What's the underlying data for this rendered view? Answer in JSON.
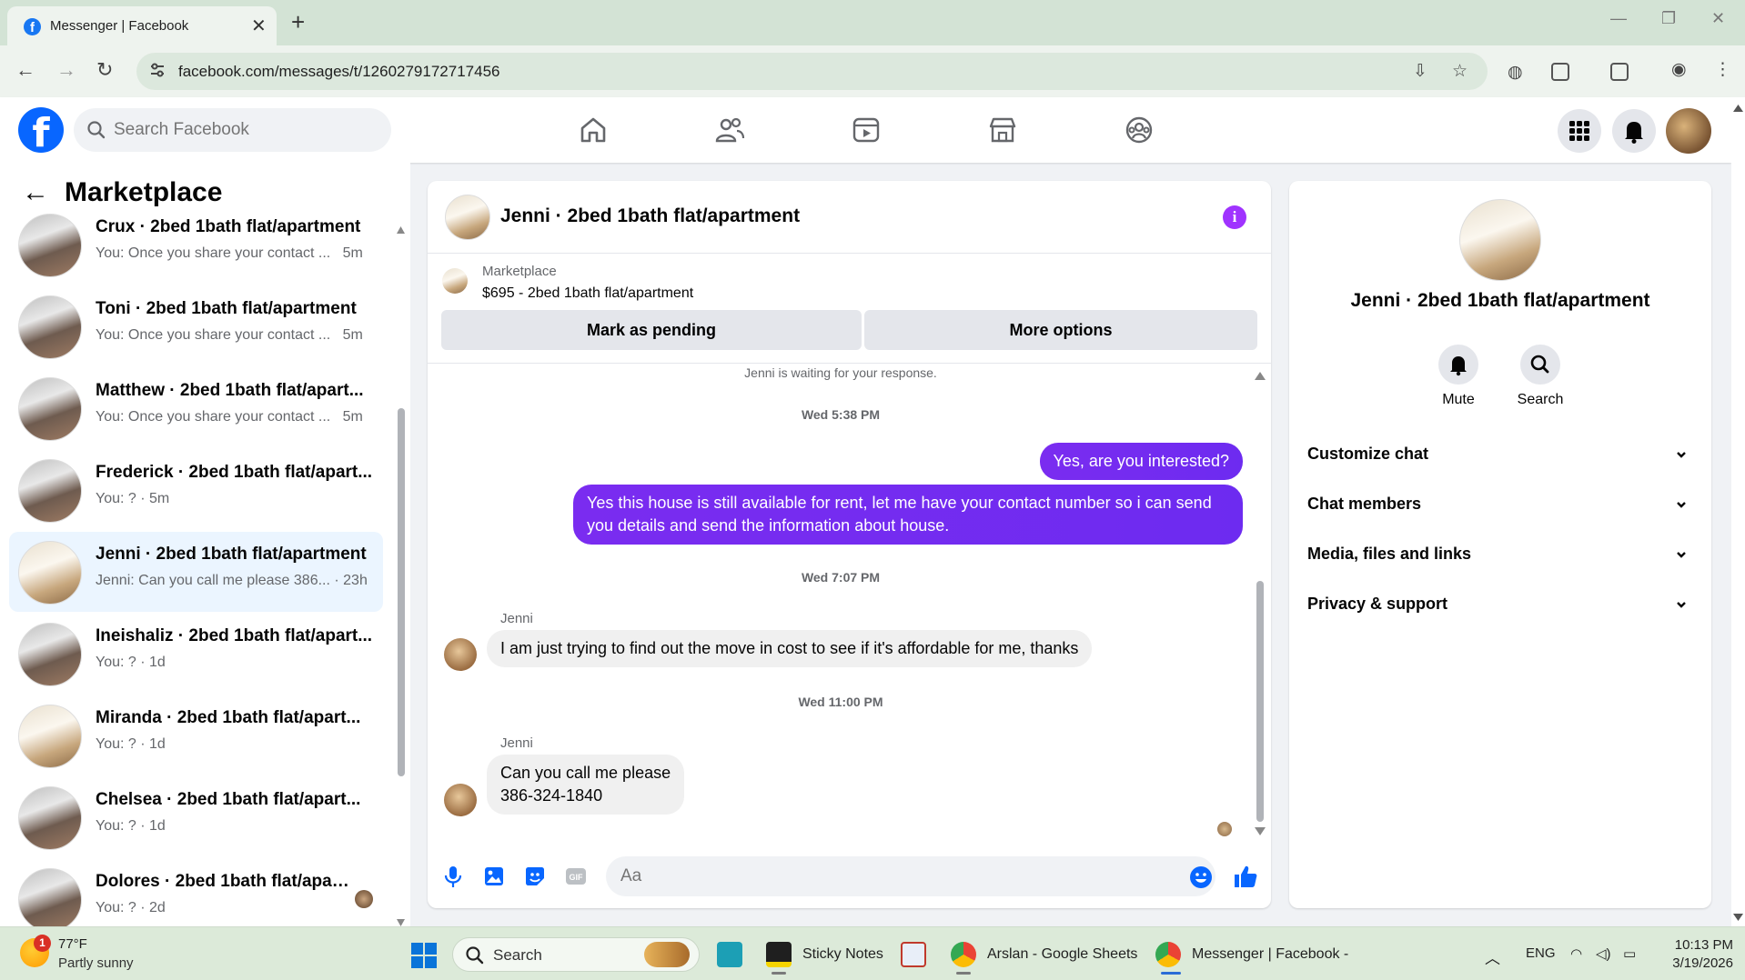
{
  "browser": {
    "tab_title": "Messenger | Facebook",
    "url": "facebook.com/messages/t/1260279172717456"
  },
  "header": {
    "search_placeholder": "Search Facebook"
  },
  "sidebar": {
    "title": "Marketplace",
    "conversations": [
      {
        "name": "Crux · 2bed 1bath flat/apartment",
        "preview": "You: Once you share your contact ...",
        "time": "5m",
        "active": false
      },
      {
        "name": "Toni · 2bed 1bath flat/apartment",
        "preview": "You: Once you share your contact ...",
        "time": "5m",
        "active": false
      },
      {
        "name": "Matthew · 2bed 1bath flat/apart...",
        "preview": "You: Once you share your contact ...",
        "time": "5m",
        "active": false
      },
      {
        "name": "Frederick · 2bed 1bath flat/apart...",
        "preview": "You: ? · 5m",
        "time": "",
        "active": false
      },
      {
        "name": "Jenni · 2bed 1bath flat/apartment",
        "preview": "Jenni: Can you call me please 386... · 23h",
        "time": "",
        "active": true
      },
      {
        "name": "Ineishaliz · 2bed 1bath flat/apart...",
        "preview": "You: ? · 1d",
        "time": "",
        "active": false
      },
      {
        "name": "Miranda · 2bed 1bath flat/apart...",
        "preview": "You: ? · 1d",
        "time": "",
        "active": false
      },
      {
        "name": "Chelsea · 2bed 1bath flat/apart...",
        "preview": "You: ? · 1d",
        "time": "",
        "active": false
      },
      {
        "name": "Dolores · 2bed 1bath flat/apar...",
        "preview": "You: ? · 2d",
        "time": "",
        "active": false
      }
    ]
  },
  "chat": {
    "title": "Jenni · 2bed 1bath flat/apartment",
    "listing_label": "Marketplace",
    "listing_price": "$695 - 2bed 1bath flat/apartment",
    "mark_pending": "Mark as pending",
    "more_options": "More options",
    "waiting": "Jenni is waiting for your response.",
    "ts1": "Wed 5:38 PM",
    "out1": "Yes, are you interested?",
    "out2": "Yes this house is still available for rent, let me have your contact number so i can send you details and send the information about house.",
    "ts2": "Wed 7:07 PM",
    "sender1": "Jenni",
    "in1": "I am just trying to find out the move in cost to see if it's affordable for me, thanks",
    "ts3": "Wed 11:00 PM",
    "sender2": "Jenni",
    "in2_line1": "Can you call me please",
    "in2_line2": "386-324-1840",
    "composer_placeholder": "Aa"
  },
  "details": {
    "name": "Jenni · 2bed 1bath flat/apartment",
    "mute": "Mute",
    "search": "Search",
    "sections": [
      "Customize chat",
      "Chat members",
      "Media, files and links",
      "Privacy & support"
    ]
  },
  "taskbar": {
    "weather_temp": "77°F",
    "weather_cond": "Partly sunny",
    "weather_badge": "1",
    "search": "Search",
    "apps": [
      "Sticky Notes",
      "Arslan - Google Sheets",
      "Messenger | Facebook -"
    ],
    "lang": "ENG",
    "time": "10:13 PM",
    "date": "3/19/2026"
  },
  "colors": {
    "accent": "#0866ff",
    "outgoing_bubble": "#7a2cf0",
    "active_item": "#ebf5ff"
  }
}
